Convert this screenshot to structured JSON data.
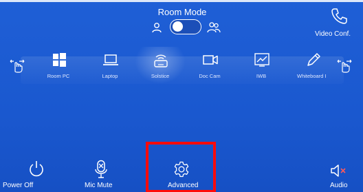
{
  "header": {
    "room_mode_title": "Room Mode",
    "left_mode_icon": "person-icon",
    "right_mode_icon": "group-icon",
    "toggle_state": "single-room"
  },
  "video_conf": {
    "label": "Video Conf.",
    "icon": "phone-icon"
  },
  "sources": [
    {
      "label": "Room PC",
      "icon": "windows-icon"
    },
    {
      "label": "Laptop",
      "icon": "laptop-icon"
    },
    {
      "label": "Solstice",
      "icon": "wireless-display-icon",
      "selected": true
    },
    {
      "label": "Doc Cam",
      "icon": "video-camera-icon"
    },
    {
      "label": "IWB",
      "icon": "chart-board-icon"
    },
    {
      "label": "Whiteboard I",
      "icon": "pen-icon"
    }
  ],
  "swipe_icons": {
    "left": "swipe-gesture-icon",
    "right": "swipe-gesture-icon"
  },
  "bottom": {
    "power_off_label": "Power Off",
    "mic_mute_label": "Mic Mute",
    "advanced_label": "Advanced",
    "audio_label": "Audio"
  },
  "colors": {
    "background": "#1f5fd6",
    "text": "#ffffff",
    "highlight_box": "#ff0b0b",
    "mute_x": "#ff5a5a"
  }
}
